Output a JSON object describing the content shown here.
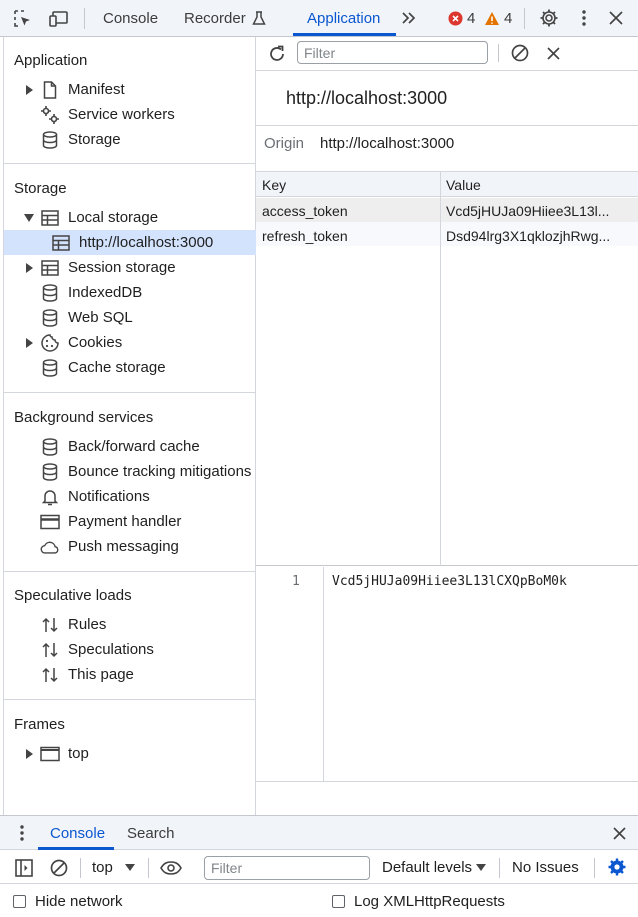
{
  "toolbar": {
    "tabs": [
      "Console",
      "Recorder",
      "Application"
    ],
    "errors_count": "4",
    "warnings_count": "4"
  },
  "sidebar": {
    "application": {
      "title": "Application",
      "items": [
        "Manifest",
        "Service workers",
        "Storage"
      ]
    },
    "storage": {
      "title": "Storage",
      "items": [
        "Local storage",
        "http://localhost:3000",
        "Session storage",
        "IndexedDB",
        "Web SQL",
        "Cookies",
        "Cache storage"
      ]
    },
    "background": {
      "title": "Background services",
      "items": [
        "Back/forward cache",
        "Bounce tracking mitigations",
        "Notifications",
        "Payment handler",
        "Push messaging"
      ]
    },
    "speculative": {
      "title": "Speculative loads",
      "items": [
        "Rules",
        "Speculations",
        "This page"
      ]
    },
    "frames": {
      "title": "Frames",
      "items": [
        "top"
      ]
    }
  },
  "main": {
    "filter_placeholder": "Filter",
    "heading": "http://localhost:3000",
    "origin_label": "Origin",
    "origin_value": "http://localhost:3000",
    "columns": [
      "Key",
      "Value"
    ],
    "rows": [
      {
        "key": "access_token",
        "value": "Vcd5jHUJa09Hiiee3L13l..."
      },
      {
        "key": "refresh_token",
        "value": "Dsd94lrg3X1qklozjhRwg..."
      }
    ],
    "preview_line_number": "1",
    "preview_text": "Vcd5jHUJa09Hiiee3L13lCXQpBoM0k"
  },
  "drawer": {
    "tabs": [
      "Console",
      "Search"
    ],
    "context": "top",
    "filter_placeholder": "Filter",
    "levels": "Default levels",
    "issues": "No Issues",
    "hide_network": "Hide network",
    "log_xhr": "Log XMLHttpRequests"
  },
  "colors": {
    "accent": "#0b57d0",
    "error": "#dc362e",
    "warning": "#e37400",
    "selected": "#d3e3fd"
  }
}
